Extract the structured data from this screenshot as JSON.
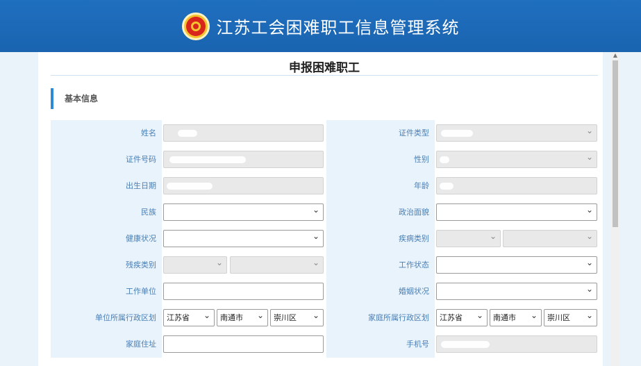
{
  "header": {
    "app_title": "江苏工会困难职工信息管理系统"
  },
  "page": {
    "title": "申报困难职工",
    "section": "基本信息"
  },
  "form": {
    "left": [
      {
        "label": "姓名"
      },
      {
        "label": "证件号码"
      },
      {
        "label": "出生日期"
      },
      {
        "label": "民族"
      },
      {
        "label": "健康状况"
      },
      {
        "label": "残疾类别"
      },
      {
        "label": "工作单位"
      },
      {
        "label": "单位所属行政区划",
        "province": "江苏省",
        "city": "南通市",
        "district": "崇川区"
      },
      {
        "label": "家庭住址"
      }
    ],
    "right": [
      {
        "label": "证件类型"
      },
      {
        "label": "性别"
      },
      {
        "label": "年龄"
      },
      {
        "label": "政治面貌"
      },
      {
        "label": "疾病类别"
      },
      {
        "label": "工作状态"
      },
      {
        "label": "婚姻状况"
      },
      {
        "label": "家庭所属行政区划",
        "province": "江苏省",
        "city": "南通市",
        "district": "崇川区"
      },
      {
        "label": "手机号"
      }
    ]
  }
}
